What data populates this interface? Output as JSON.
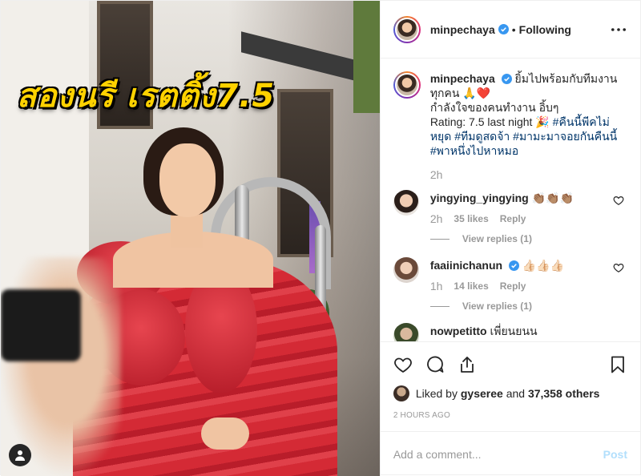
{
  "photo": {
    "headline": "สองนรี เรตติ้ง7.5"
  },
  "header": {
    "username": "minpechaya",
    "separator": "•",
    "follow_state": "Following"
  },
  "caption": {
    "username": "minpechaya",
    "line1": "ยิ้มไปพร้อมกับทีมงานทุกคน 🙏❤️",
    "line2": "กำลังใจของคนทำงาน อิ้บๆ",
    "rating_text": "Rating: 7.5 last night 🎉",
    "hashtags": [
      "#คืนนี้พีคไม่หยุด",
      "#ทีมดูสดจ้า",
      "#มามะมาจอยกันคืนนี้",
      "#พาหนึ่งไปหาหมอ"
    ],
    "age": "2h"
  },
  "comments": [
    {
      "username": "yingying_yingying",
      "text": "👏🏽👏🏽👏🏽",
      "age": "2h",
      "likes": "35 likes",
      "reply": "Reply",
      "view_replies": "View replies (1)"
    },
    {
      "username": "faaiinichanun",
      "verified": true,
      "text": "👍🏻👍🏻👍🏻",
      "age": "1h",
      "likes": "14 likes",
      "reply": "Reply",
      "view_replies": "View replies (1)"
    }
  ],
  "partial_comment": {
    "username": "nowpetitto",
    "text": "เพี่ยนยนน"
  },
  "likes": {
    "prefix": "Liked by",
    "user": "gyseree",
    "conjunction": "and",
    "others": "37,358 others"
  },
  "timestamp": "2 HOURS AGO",
  "add_comment": {
    "placeholder": "Add a comment...",
    "post_label": "Post"
  },
  "colors": {
    "verified_blue": "#3897f0",
    "headline_yellow": "#ffd200",
    "dress_red": "#d42a35",
    "hashtag_blue": "#003569",
    "post_button_disabled": "#b2dffc"
  },
  "icons": [
    "user-tag-icon",
    "verified-icon",
    "more-options-icon",
    "heart-icon",
    "comment-icon",
    "share-icon",
    "bookmark-icon"
  ]
}
